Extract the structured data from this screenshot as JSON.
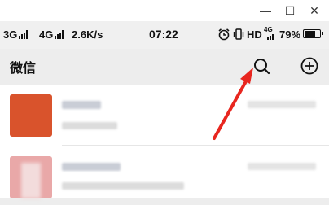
{
  "window": {
    "minimize_glyph": "—",
    "maximize_glyph": "☐",
    "close_glyph": "✕"
  },
  "status_bar": {
    "net1": "3G",
    "net2": "4G",
    "speed": "2.6K/s",
    "time": "07:22",
    "hd": "HD",
    "sim": "4G",
    "battery_percent": "79%",
    "battery_level": 0.79
  },
  "header": {
    "title": "微信",
    "search_icon": "search-icon",
    "add_icon": "add-icon"
  },
  "colors": {
    "arrow": "#e8261f",
    "avatar1": "#d9532c",
    "avatar2": "#e9a8a8"
  }
}
